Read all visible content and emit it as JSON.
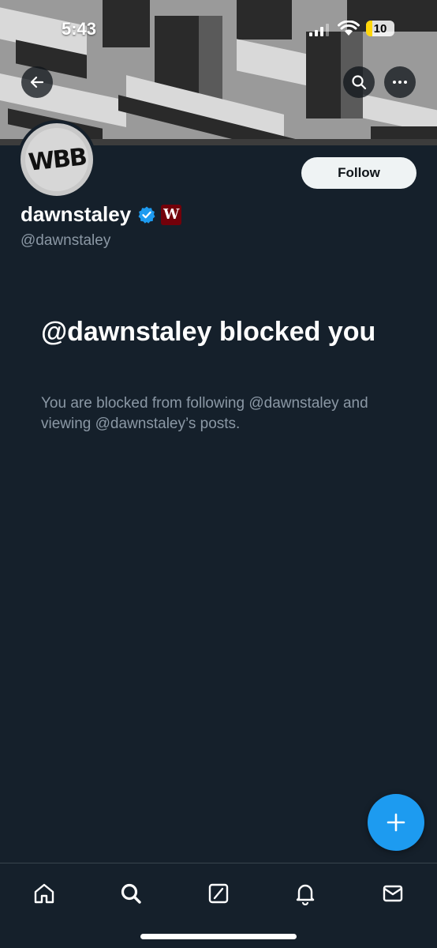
{
  "status_bar": {
    "time": "5:43",
    "battery": "10"
  },
  "profile": {
    "display_name": "dawnstaley",
    "handle": "@dawnstaley",
    "avatar_text": "WBB",
    "affiliation_text": "W",
    "follow_label": "Follow"
  },
  "blocked": {
    "title": "@dawnstaley blocked you",
    "description": "You are blocked from following @dawnstaley and viewing @dawnstaley’s posts."
  },
  "icons": {
    "back": "arrow-left-icon",
    "search": "search-icon",
    "more": "more-icon",
    "compose": "plus-icon",
    "tabs": [
      "home-icon",
      "search-icon",
      "grok-icon",
      "bell-icon",
      "mail-icon"
    ]
  },
  "colors": {
    "accent": "#1d9bf0",
    "background": "#15202b",
    "secondary_text": "#8b98a5"
  }
}
